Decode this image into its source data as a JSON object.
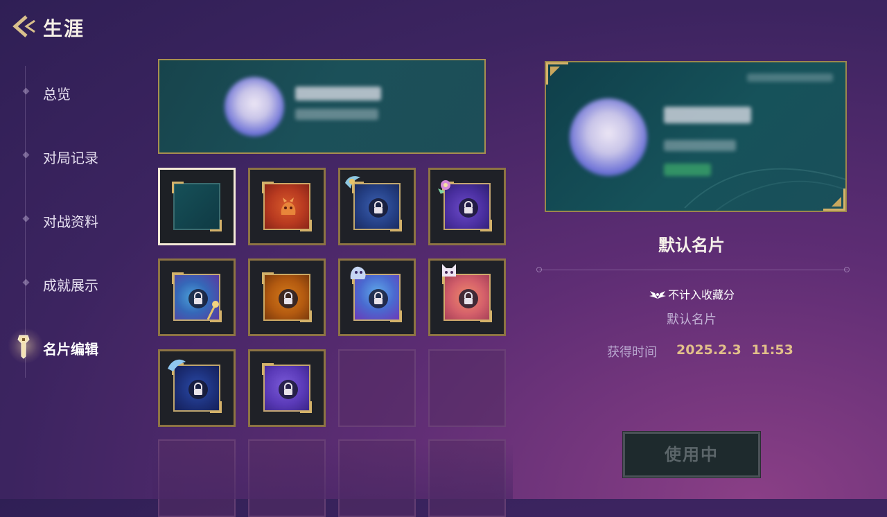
{
  "header": {
    "title": "生涯",
    "back_icon": "back-arrow-icon"
  },
  "sidebar": {
    "items": [
      {
        "label": "总览",
        "active": false
      },
      {
        "label": "对局记录",
        "active": false
      },
      {
        "label": "对战资料",
        "active": false
      },
      {
        "label": "成就展示",
        "active": false
      },
      {
        "label": "名片编辑",
        "active": true,
        "icon": "key-icon"
      }
    ]
  },
  "grid": {
    "tiles": [
      {
        "state": "selected",
        "theme": "teal-default"
      },
      {
        "state": "owned",
        "theme": "red-orange"
      },
      {
        "state": "locked",
        "theme": "blue-ornate"
      },
      {
        "state": "locked",
        "theme": "purple-floral"
      },
      {
        "state": "locked",
        "theme": "blue-swirl-gold"
      },
      {
        "state": "locked",
        "theme": "amber"
      },
      {
        "state": "locked",
        "theme": "blue-purple-spirit"
      },
      {
        "state": "locked",
        "theme": "pink-coral"
      },
      {
        "state": "locked",
        "theme": "navy-wave"
      },
      {
        "state": "locked",
        "theme": "violet-galaxy"
      },
      {
        "state": "empty"
      },
      {
        "state": "empty"
      },
      {
        "state": "empty"
      },
      {
        "state": "empty"
      },
      {
        "state": "empty"
      },
      {
        "state": "empty"
      }
    ]
  },
  "detail": {
    "name": "默认名片",
    "collect_note": "不计入收藏分",
    "description": "默认名片",
    "obtain_label": "获得时间",
    "obtain_value": "2025.2.3 11:53",
    "use_button": "使用中"
  },
  "colors": {
    "gold": "#d4b26a",
    "teal_card": "#16525a",
    "bg_purple": "#3c2460"
  }
}
